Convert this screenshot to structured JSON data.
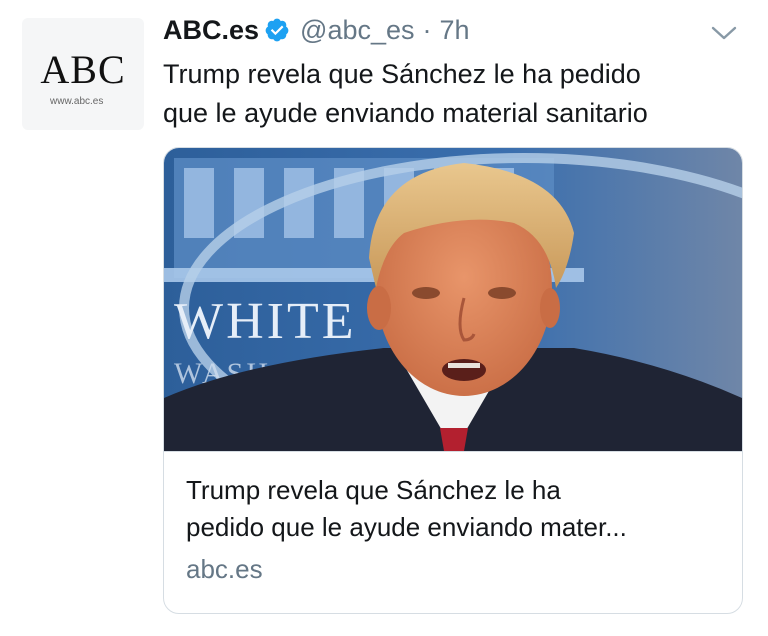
{
  "tweet": {
    "display_name": "ABC.es",
    "handle": "@abc_es",
    "separator": "·",
    "time": "7h",
    "text_line1": "Trump revela que Sánchez le ha pedido",
    "text_line2": "que le ayude enviando material sanitario",
    "verified": true
  },
  "avatar": {
    "wordmark": "ABC",
    "site": "www.abc.es"
  },
  "card": {
    "title_line1": "Trump revela que Sánchez le ha",
    "title_line2": "pedido que le ayude enviando mater...",
    "domain": "abc.es",
    "image_text": "WHITE",
    "image_text2": "WASH"
  },
  "icons": {
    "verified": "verified-badge-icon",
    "more": "chevron-down-icon"
  },
  "colors": {
    "verified_blue": "#1da1f2",
    "secondary_text": "#657786",
    "primary_text": "#14171a",
    "card_border": "#d6dde3"
  }
}
